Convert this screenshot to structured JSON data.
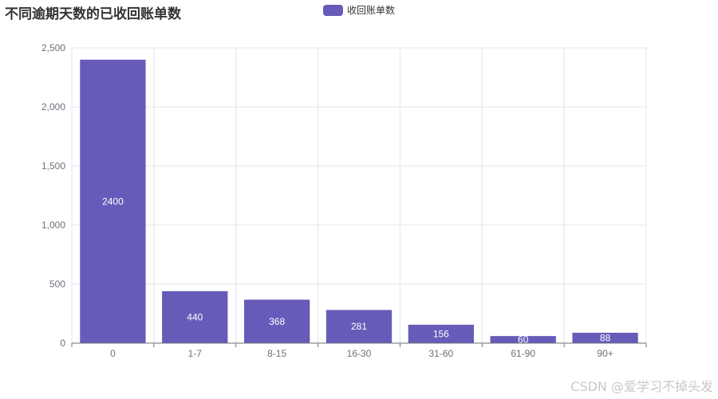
{
  "colors": {
    "bar": "#675bba",
    "axis": "#6e7079",
    "grid": "#e0e6f1",
    "title": "#333333",
    "label": "#ffffff"
  },
  "title": "不同逾期天数的已收回账单数",
  "legend": {
    "label": "收回账单数"
  },
  "watermark": "CSDN @爱学习不掉头发",
  "chart_data": {
    "type": "bar",
    "title": "不同逾期天数的已收回账单数",
    "categories": [
      "0",
      "1-7",
      "8-15",
      "16-30",
      "31-60",
      "61-90",
      "90+"
    ],
    "series": [
      {
        "name": "收回账单数",
        "values": [
          2400,
          440,
          368,
          281,
          156,
          60,
          88
        ]
      }
    ],
    "ylim": [
      0,
      2500
    ],
    "yticks": [
      0,
      500,
      1000,
      1500,
      2000,
      2500
    ],
    "ytick_labels": [
      "0",
      "500",
      "1,000",
      "1,500",
      "2,000",
      "2,500"
    ],
    "grid": true,
    "legend_position": "top-center",
    "data_labels": "inside"
  }
}
